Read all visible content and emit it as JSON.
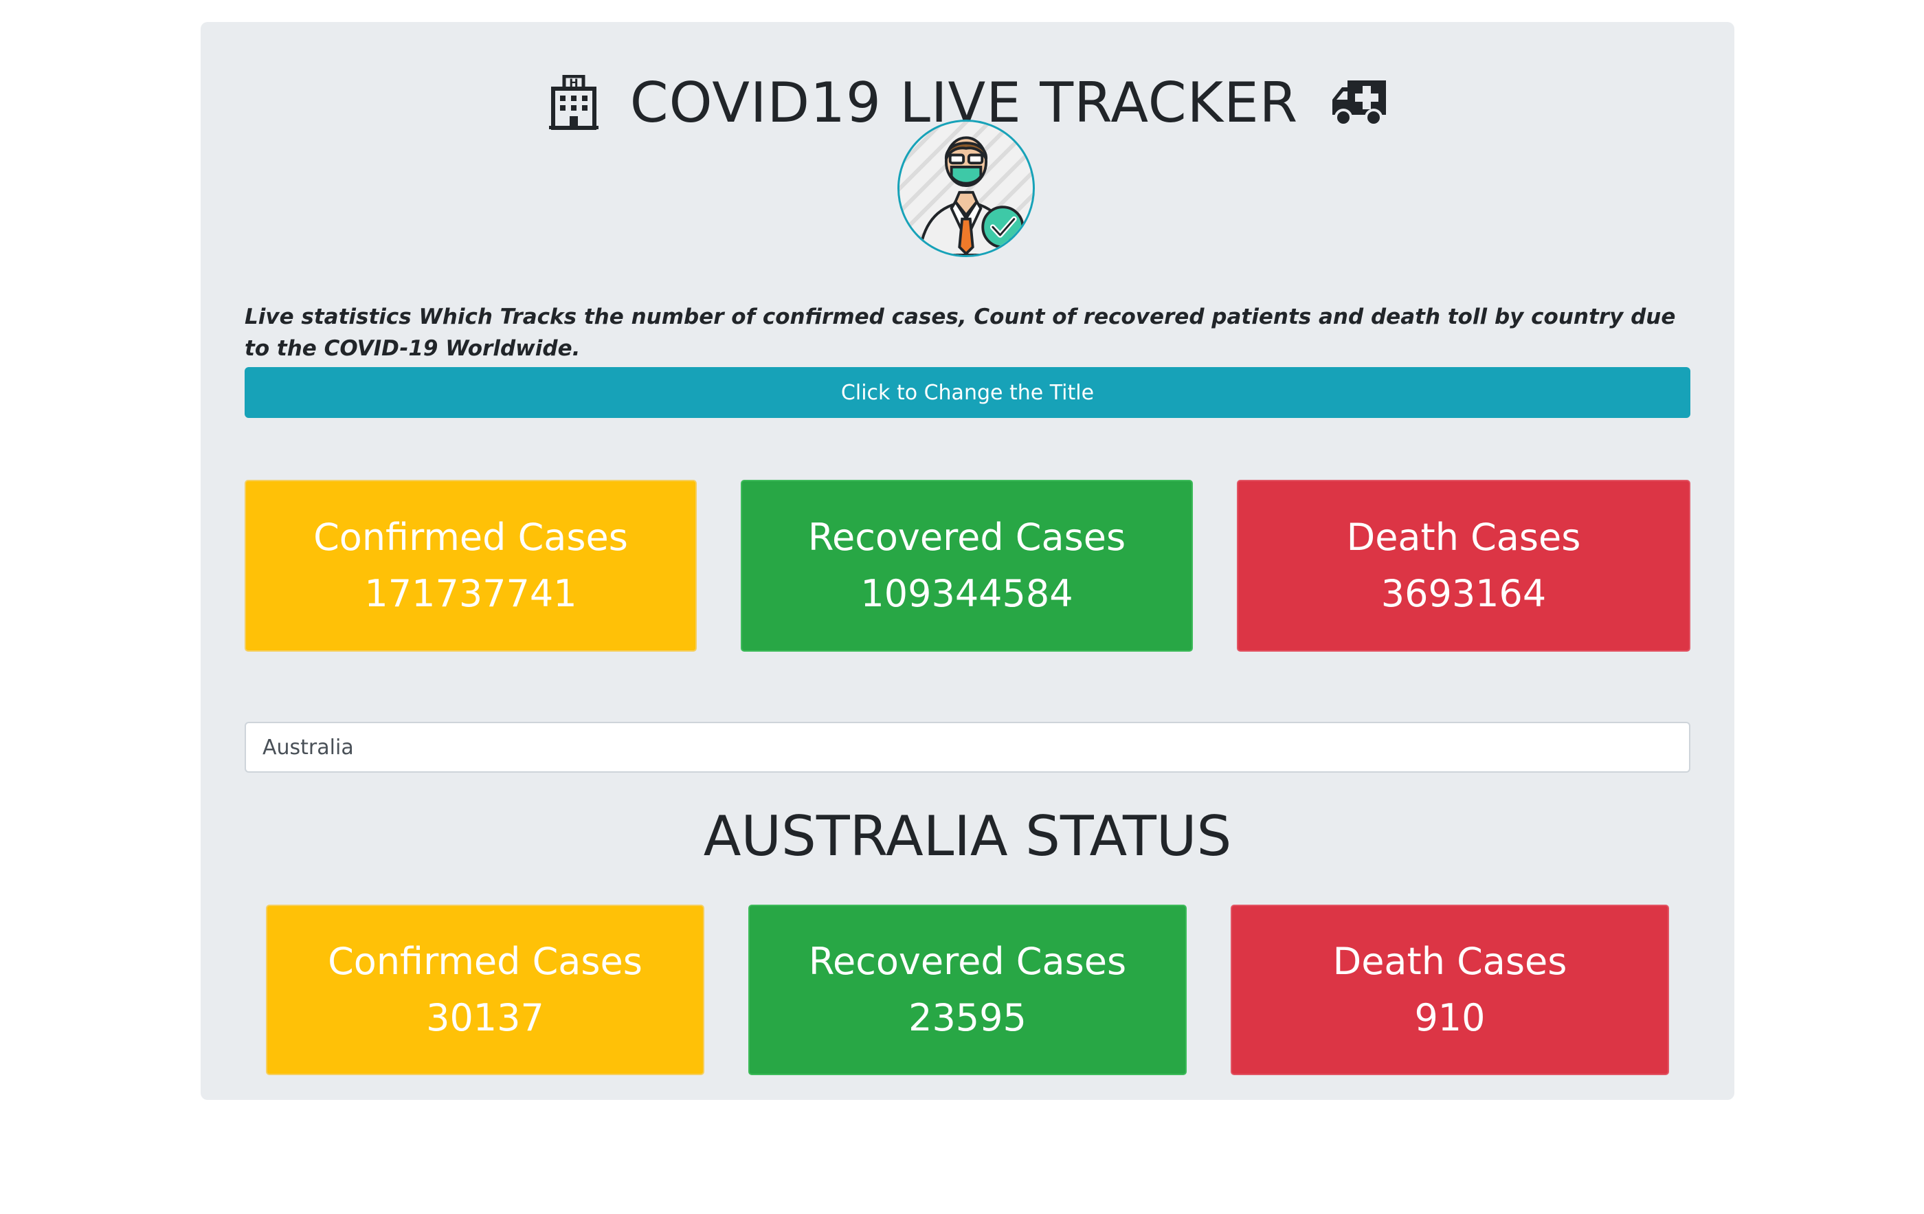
{
  "header": {
    "title": "COVID19 LIVE TRACKER",
    "left_icon": "hospital-icon",
    "right_icon": "ambulance-icon"
  },
  "avatar": {
    "icon": "masked-doctor-avatar"
  },
  "description": "Live statistics Which Tracks the number of confirmed cases, Count of recovered patients and death toll by country due to the COVID-19 Worldwide.",
  "change_title_button": "Click to Change the Title",
  "global": {
    "confirmed": {
      "label": "Confirmed Cases",
      "value": "171737741"
    },
    "recovered": {
      "label": "Recovered Cases",
      "value": "109344584"
    },
    "deaths": {
      "label": "Death Cases",
      "value": "3693164"
    }
  },
  "search": {
    "value": "Australia"
  },
  "country": {
    "title": "AUSTRALIA STATUS",
    "confirmed": {
      "label": "Confirmed Cases",
      "value": "30137"
    },
    "recovered": {
      "label": "Recovered Cases",
      "value": "23595"
    },
    "deaths": {
      "label": "Death Cases",
      "value": "910"
    }
  },
  "colors": {
    "panel": "#e9ecef",
    "info": "#17a2b8",
    "warning": "#ffc107",
    "success": "#28a745",
    "danger": "#dc3545"
  }
}
